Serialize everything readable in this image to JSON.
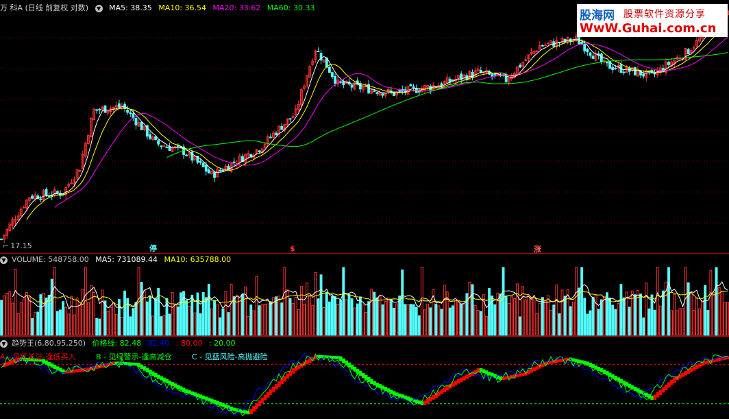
{
  "main_header": {
    "title": "万 科A (日线 前复权 对数)",
    "ma5": "MA5: 38.35",
    "ma10": "MA10: 36.54",
    "ma20": "MA20: 33.62",
    "ma60": "MA60: 30.33"
  },
  "low_label": "17.15",
  "markers": [
    "停",
    "$",
    "涨"
  ],
  "volume_header": {
    "title": "VOLUME: 548758.00",
    "ma5": "MA5: 731089.44",
    "ma10": "MA10: 635788.00"
  },
  "indicator_header": {
    "title": "趋势王(6,80,95,250)",
    "price": "价格线: 82.48",
    "v2": "82.40",
    "v3": ": 80.00",
    "v4": ": 20.00"
  },
  "legend": {
    "a": "A - 见红关注-逢低买入",
    "b": "B - 见绿警示-逢高减仓",
    "c": "C - 见蓝风险-高抛避险"
  },
  "logo": {
    "name": "股海网",
    "tagline": "股票软件资源分享",
    "url": "WwW.Guhai.com.cn"
  },
  "colors": {
    "up": "#ff3232",
    "down": "#54ffff",
    "ma5": "#ffffff",
    "ma10": "#ffff00",
    "ma20": "#ff00ff",
    "ma60": "#00ff00",
    "grid": "#8b0000",
    "indicator_up": "#ff0000",
    "indicator_down": "#00ff00",
    "price_line": "#00ff00",
    "fast_line": "#0000ff"
  },
  "chart_data": [
    {
      "type": "candlestick",
      "title": "万 科A (日线 前复权 对数)",
      "log_scale": true,
      "y_min_label": 17.15,
      "ylim": [
        17.15,
        42.0
      ],
      "trend_keypoints": [
        [
          0,
          17.3
        ],
        [
          10,
          20.5
        ],
        [
          22,
          20.8
        ],
        [
          28,
          23.0
        ],
        [
          33,
          28.8
        ],
        [
          43,
          29.3
        ],
        [
          55,
          25.3
        ],
        [
          65,
          24.5
        ],
        [
          75,
          22.3
        ],
        [
          92,
          24.8
        ],
        [
          105,
          28.5
        ],
        [
          112,
          36.8
        ],
        [
          120,
          32.0
        ],
        [
          140,
          30.8
        ],
        [
          155,
          31.8
        ],
        [
          170,
          33.5
        ],
        [
          180,
          32.5
        ],
        [
          192,
          37.2
        ],
        [
          205,
          38.2
        ],
        [
          215,
          34.5
        ],
        [
          232,
          33.0
        ],
        [
          245,
          36.5
        ],
        [
          258,
          42.0
        ]
      ],
      "series": [
        "MA5",
        "MA10",
        "MA20",
        "MA60"
      ]
    },
    {
      "type": "bar",
      "title": "VOLUME: 548758.00",
      "last_value": 548758.0,
      "ma5_last": 731089.44,
      "ma10_last": 635788.0,
      "ylim": [
        0,
        1150000
      ]
    },
    {
      "type": "line",
      "title": "趋势王(6,80,95,250)",
      "price_line_last": 82.48,
      "value2_last": 82.4,
      "levels": [
        80.0,
        20.0
      ],
      "ylim": [
        0,
        100
      ],
      "cycle_keypoints": [
        [
          0,
          78
        ],
        [
          6,
          88
        ],
        [
          14,
          86
        ],
        [
          22,
          68
        ],
        [
          30,
          72
        ],
        [
          40,
          82
        ],
        [
          48,
          80
        ],
        [
          55,
          62
        ],
        [
          65,
          40
        ],
        [
          75,
          24
        ],
        [
          82,
          12
        ],
        [
          88,
          6
        ],
        [
          96,
          40
        ],
        [
          104,
          72
        ],
        [
          112,
          92
        ],
        [
          120,
          90
        ],
        [
          132,
          52
        ],
        [
          140,
          35
        ],
        [
          150,
          20
        ],
        [
          160,
          48
        ],
        [
          170,
          72
        ],
        [
          178,
          58
        ],
        [
          186,
          65
        ],
        [
          194,
          82
        ],
        [
          202,
          88
        ],
        [
          208,
          82
        ],
        [
          214,
          70
        ],
        [
          224,
          46
        ],
        [
          232,
          28
        ],
        [
          240,
          58
        ],
        [
          250,
          82
        ],
        [
          258,
          90
        ]
      ]
    }
  ]
}
